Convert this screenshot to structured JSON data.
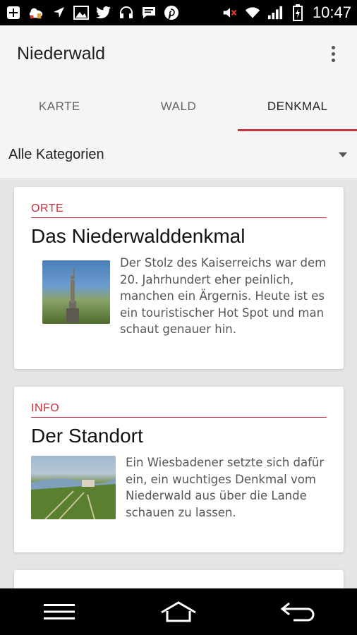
{
  "status_bar": {
    "time": "10:47",
    "icons": [
      "plus-box-icon",
      "cloud-upload-icon",
      "navigation-icon",
      "image-icon",
      "twitter-icon",
      "headset-icon",
      "chat-icon",
      "pinterest-icon",
      "mute-icon",
      "wifi-icon",
      "signal-icon",
      "battery-charging-icon"
    ]
  },
  "app": {
    "title": "Niederwald"
  },
  "tabs": [
    {
      "label": "KARTE",
      "active": false
    },
    {
      "label": "WALD",
      "active": false
    },
    {
      "label": "DENKMAL",
      "active": true
    }
  ],
  "filter": {
    "label": "Alle Kategorien"
  },
  "cards": [
    {
      "category": "ORTE",
      "title": "Das Niederwalddenkmal",
      "text": "Der Stolz des Kaiserreichs war dem 20. Jahrhundert eher peinlich, manchen ein Ärgernis. Heute ist es ein touristischer Hot Spot und man schaut genauer hin."
    },
    {
      "category": "INFO",
      "title": "Der Standort",
      "text": "Ein Wiesbadener setzte sich dafür ein, ein wuchtiges Denkmal vom Niederwald aus über die Lande schauen zu lassen."
    }
  ],
  "colors": {
    "accent": "#c8323c",
    "background": "#e5e5e5",
    "surface": "#f5f5f5"
  },
  "nav_bar": {
    "icons": [
      "menu-icon",
      "home-icon",
      "back-icon"
    ]
  }
}
